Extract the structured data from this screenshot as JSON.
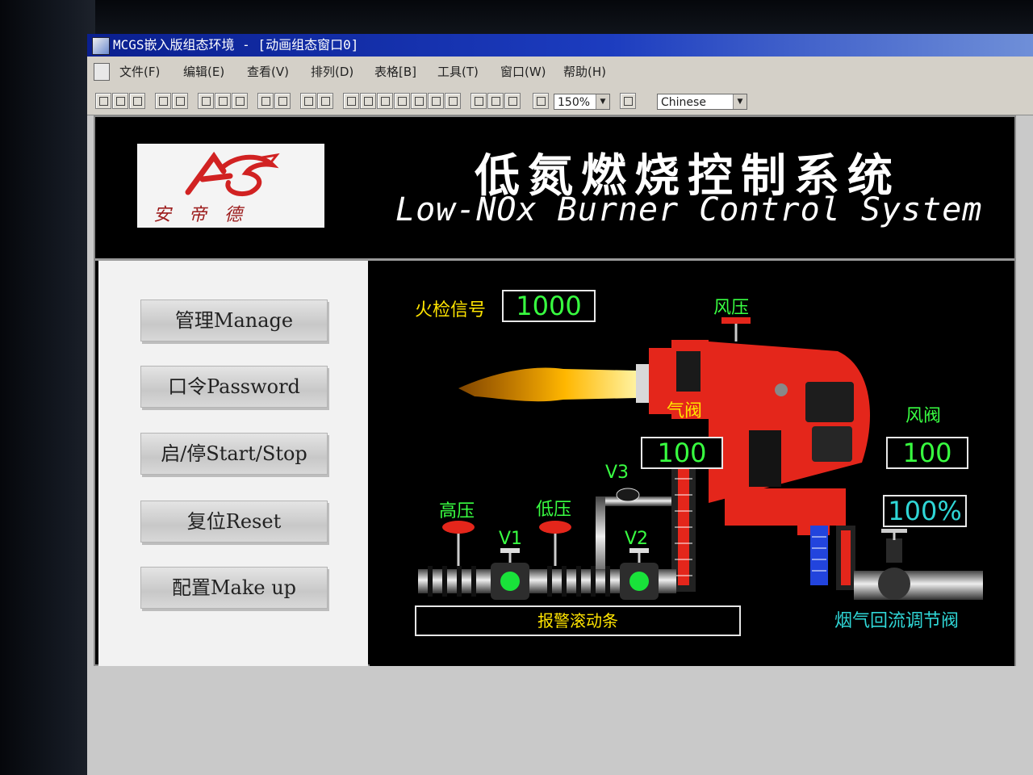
{
  "window": {
    "title": "MCGS嵌入版组态环境 - [动画组态窗口0]"
  },
  "menu": [
    "文件(F)",
    "编辑(E)",
    "查看(V)",
    "排列(D)",
    "表格[B]",
    "工具(T)",
    "窗口(W)",
    "帮助(H)"
  ],
  "toolbar": {
    "zoom": "150%",
    "language": "Chinese"
  },
  "header": {
    "title_cn": "低氮燃烧控制系统",
    "title_en": "Low-NOx Burner Control System",
    "logo_text": "安帝德"
  },
  "nav": [
    {
      "label": "管理Manage"
    },
    {
      "label": "口令Password"
    },
    {
      "label": "启/停Start/Stop"
    },
    {
      "label": "复位Reset"
    },
    {
      "label": "配置Make up"
    }
  ],
  "process": {
    "flame_signal_label": "火检信号",
    "flame_signal_value": "1000",
    "air_pressure_label": "风压",
    "gas_valve_label": "气阀",
    "gas_valve_value": "100",
    "air_damper_label": "风阀",
    "air_damper_value": "100",
    "air_damper_percent": "100%",
    "high_pressure_label": "高压",
    "low_pressure_label": "低压",
    "v1": "V1",
    "v2": "V2",
    "v3": "V3",
    "alarm_ticker": "报警滚动条",
    "fgr_valve_label": "烟气回流调节阀"
  },
  "colors": {
    "burner_red": "#e4261b",
    "label_yellow": "#ffe400",
    "value_green": "#38ff40",
    "label_cyan": "#2fd6d6"
  }
}
